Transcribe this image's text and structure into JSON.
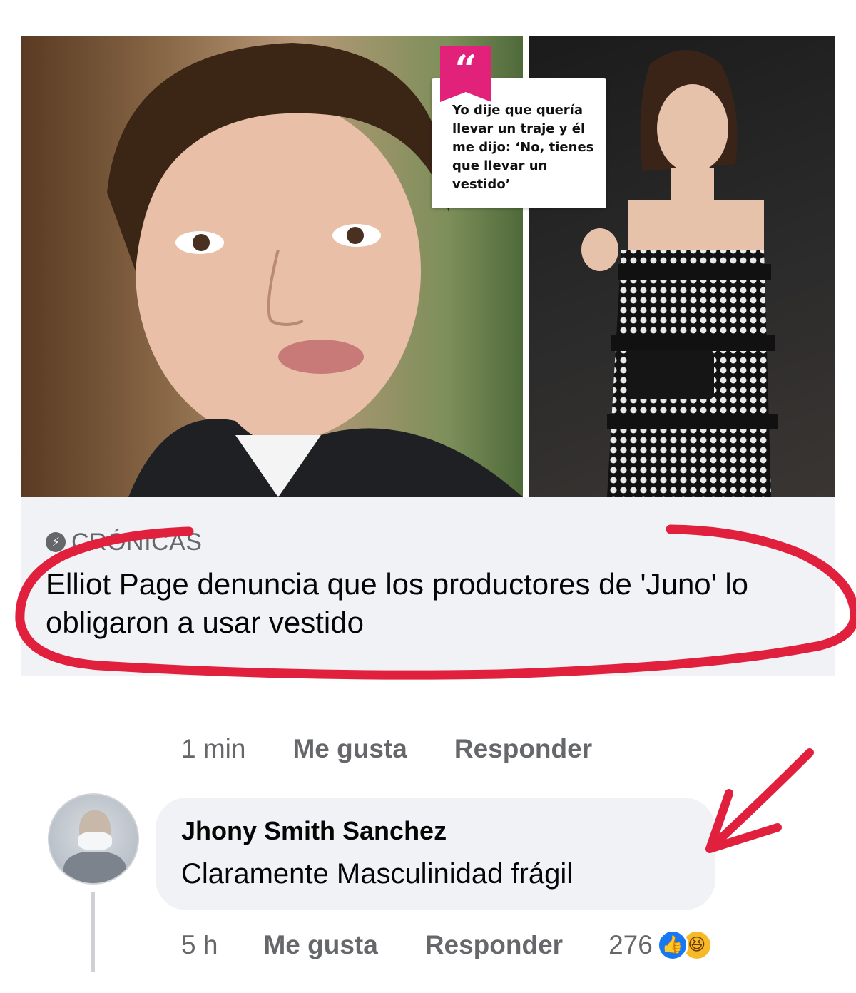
{
  "link_preview": {
    "quote": {
      "mark": "“",
      "text": "Yo dije que quería llevar un traje y él me dijo: ‘No, tienes que llevar un vestido’"
    },
    "source": {
      "icon": "lightning-icon",
      "label": "CRÓNICAS"
    },
    "headline": "Elliot Page denuncia que los productores de 'Juno' lo obligaron a usar vestido"
  },
  "post_actions": {
    "time": "1 min",
    "like_label": "Me gusta",
    "reply_label": "Responder"
  },
  "comment": {
    "author": "Jhony Smith Sanchez",
    "text": "Claramente Masculinidad frágil",
    "time": "5 h",
    "like_label": "Me gusta",
    "reply_label": "Responder",
    "reaction_count": "276",
    "reactions": [
      "like-icon",
      "haha-icon"
    ]
  },
  "colors": {
    "annotation_red": "#e0203c",
    "badge_pink": "#e2217a",
    "facebook_blue": "#1877f2",
    "secondary_text": "#65676b",
    "bubble_bg": "#f0f2f5"
  }
}
